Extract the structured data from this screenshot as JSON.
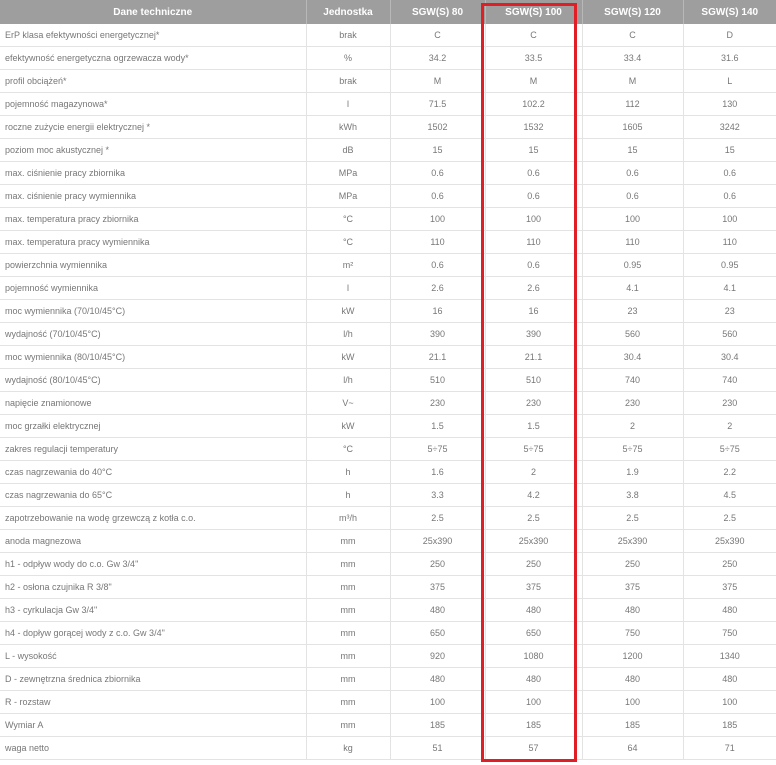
{
  "table": {
    "headers": [
      "Dane techniczne",
      "Jednostka",
      "SGW(S) 80",
      "SGW(S) 100",
      "SGW(S) 120",
      "SGW(S) 140"
    ],
    "rows": [
      [
        "ErP klasa efektywności energetycznej*",
        "brak",
        "C",
        "C",
        "C",
        "D"
      ],
      [
        "efektywność energetyczna ogrzewacza wody*",
        "%",
        "34.2",
        "33.5",
        "33.4",
        "31.6"
      ],
      [
        "profil obciążeń*",
        "brak",
        "M",
        "M",
        "M",
        "L"
      ],
      [
        "pojemność magazynowa*",
        "l",
        "71.5",
        "102.2",
        "112",
        "130"
      ],
      [
        "roczne zużycie energii elektrycznej *",
        "kWh",
        "1502",
        "1532",
        "1605",
        "3242"
      ],
      [
        "poziom moc akustycznej *",
        "dB",
        "15",
        "15",
        "15",
        "15"
      ],
      [
        "max. ciśnienie pracy zbiornika",
        "MPa",
        "0.6",
        "0.6",
        "0.6",
        "0.6"
      ],
      [
        "max. ciśnienie pracy wymiennika",
        "MPa",
        "0.6",
        "0.6",
        "0.6",
        "0.6"
      ],
      [
        "max. temperatura pracy zbiornika",
        "°C",
        "100",
        "100",
        "100",
        "100"
      ],
      [
        "max. temperatura pracy wymiennika",
        "°C",
        "110",
        "110",
        "110",
        "110"
      ],
      [
        "powierzchnia wymiennika",
        "m²",
        "0.6",
        "0.6",
        "0.95",
        "0.95"
      ],
      [
        "pojemność wymiennika",
        "l",
        "2.6",
        "2.6",
        "4.1",
        "4.1"
      ],
      [
        "moc wymiennika (70/10/45°C)",
        "kW",
        "16",
        "16",
        "23",
        "23"
      ],
      [
        "wydajność (70/10/45°C)",
        "l/h",
        "390",
        "390",
        "560",
        "560"
      ],
      [
        "moc wymiennika (80/10/45°C)",
        "kW",
        "21.1",
        "21.1",
        "30.4",
        "30.4"
      ],
      [
        "wydajność (80/10/45°C)",
        "l/h",
        "510",
        "510",
        "740",
        "740"
      ],
      [
        "napięcie znamionowe",
        "V~",
        "230",
        "230",
        "230",
        "230"
      ],
      [
        "moc grzałki elektrycznej",
        "kW",
        "1.5",
        "1.5",
        "2",
        "2"
      ],
      [
        "zakres regulacji temperatury",
        "°C",
        "5÷75",
        "5÷75",
        "5÷75",
        "5÷75"
      ],
      [
        "czas nagrzewania do 40°C",
        "h",
        "1.6",
        "2",
        "1.9",
        "2.2"
      ],
      [
        "czas nagrzewania do 65°C",
        "h",
        "3.3",
        "4.2",
        "3.8",
        "4.5"
      ],
      [
        "zapotrzebowanie na wodę grzewczą z kotła c.o.",
        "m³/h",
        "2.5",
        "2.5",
        "2.5",
        "2.5"
      ],
      [
        "anoda magnezowa",
        "mm",
        "25x390",
        "25x390",
        "25x390",
        "25x390"
      ],
      [
        "h1 - odpływ wody do c.o. Gw 3/4\"",
        "mm",
        "250",
        "250",
        "250",
        "250"
      ],
      [
        "h2 - osłona czujnika R 3/8\"",
        "mm",
        "375",
        "375",
        "375",
        "375"
      ],
      [
        "h3 - cyrkulacja Gw 3/4\"",
        "mm",
        "480",
        "480",
        "480",
        "480"
      ],
      [
        "h4 - dopływ gorącej wody z c.o. Gw 3/4\"",
        "mm",
        "650",
        "650",
        "750",
        "750"
      ],
      [
        "L - wysokość",
        "mm",
        "920",
        "1080",
        "1200",
        "1340"
      ],
      [
        "D - zewnętrzna średnica zbiornika",
        "mm",
        "480",
        "480",
        "480",
        "480"
      ],
      [
        "R - rozstaw",
        "mm",
        "100",
        "100",
        "100",
        "100"
      ],
      [
        "Wymiar A",
        "mm",
        "185",
        "185",
        "185",
        "185"
      ],
      [
        "waga netto",
        "kg",
        "51",
        "57",
        "64",
        "71"
      ]
    ]
  },
  "colors": {
    "header_background": "#9e9e9e",
    "header_text": "#ffffff",
    "cell_text": "#777777",
    "grid_line": "#e3e3e3",
    "highlight": "#e01e26"
  }
}
